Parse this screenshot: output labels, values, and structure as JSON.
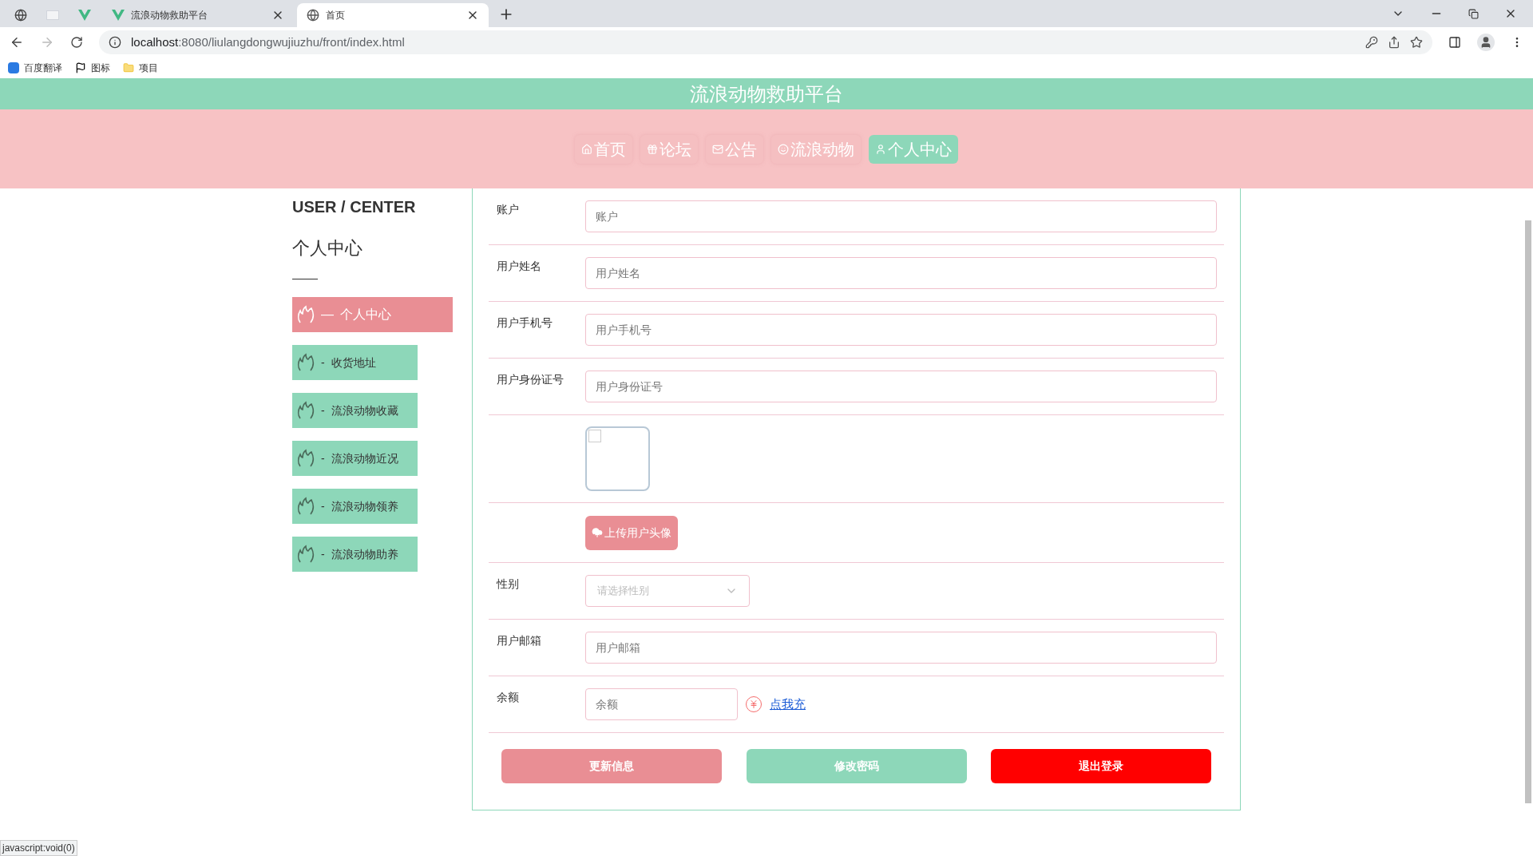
{
  "browser": {
    "tabs": [
      {
        "kind": "pinned-globe",
        "selected": false
      },
      {
        "kind": "pinned-blank",
        "selected": false
      },
      {
        "kind": "pinned-v",
        "selected": false
      },
      {
        "kind": "page",
        "title": "流浪动物救助平台",
        "selected": false
      },
      {
        "kind": "page",
        "title": "首页",
        "selected": true
      }
    ],
    "url_host": "localhost",
    "url_rest": ":8080/liulangdongwujiuzhu/front/index.html",
    "bookmarks": [
      {
        "kind": "translate",
        "label": "百度翻译"
      },
      {
        "kind": "flag",
        "label": "图标"
      },
      {
        "kind": "folder",
        "label": "项目"
      }
    ]
  },
  "header": {
    "title": "流浪动物救助平台"
  },
  "nav": [
    {
      "kind": "home",
      "label": "首页",
      "selected": false
    },
    {
      "kind": "forum",
      "label": "论坛",
      "selected": false
    },
    {
      "kind": "mail",
      "label": "公告",
      "selected": false
    },
    {
      "kind": "smile",
      "label": "流浪动物",
      "selected": false
    },
    {
      "kind": "user",
      "label": "个人中心",
      "selected": true
    }
  ],
  "sidebar": {
    "title": "USER / CENTER",
    "subtitle": "个人中心",
    "items": [
      {
        "prefix": "—",
        "label": "个人中心",
        "selected": true
      },
      {
        "prefix": "-",
        "label": "收货地址",
        "selected": false
      },
      {
        "prefix": "-",
        "label": "流浪动物收藏",
        "selected": false
      },
      {
        "prefix": "-",
        "label": "流浪动物近况",
        "selected": false
      },
      {
        "prefix": "-",
        "label": "流浪动物领养",
        "selected": false
      },
      {
        "prefix": "-",
        "label": "流浪动物助养",
        "selected": false
      }
    ]
  },
  "form": [
    {
      "kind": "input",
      "label": "账户",
      "placeholder": "账户"
    },
    {
      "kind": "input",
      "label": "用户姓名",
      "placeholder": "用户姓名"
    },
    {
      "kind": "input",
      "label": "用户手机号",
      "placeholder": "用户手机号"
    },
    {
      "kind": "input",
      "label": "用户身份证号",
      "placeholder": "用户身份证号"
    },
    {
      "kind": "avatar"
    },
    {
      "kind": "upload",
      "button": "上传用户头像"
    },
    {
      "kind": "select",
      "label": "性别",
      "placeholder": "请选择性别"
    },
    {
      "kind": "input",
      "label": "用户邮箱",
      "placeholder": "用户邮箱"
    },
    {
      "kind": "balance",
      "label": "余额",
      "placeholder": "余额",
      "link": "点我充"
    }
  ],
  "buttons": [
    {
      "label": "更新信息",
      "color": "#e98e94"
    },
    {
      "label": "修改密码",
      "color": "#8dd7b9"
    },
    {
      "label": "退出登录",
      "color": "#ff0000"
    }
  ],
  "status_bar": "javascript:void(0)"
}
